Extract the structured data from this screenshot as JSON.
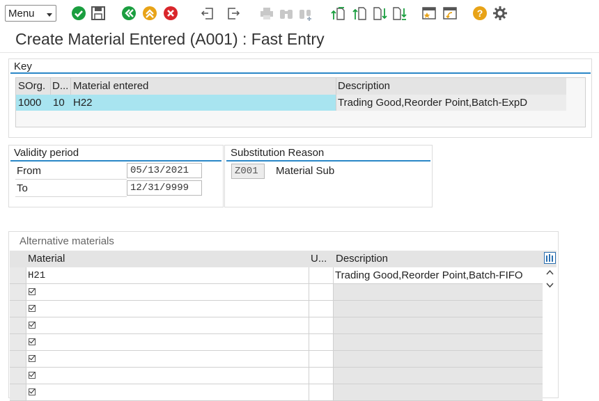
{
  "toolbar": {
    "menu_label": "Menu",
    "icons": [
      "check-icon",
      "save-icon",
      "back-icon",
      "exit-icon",
      "cancel-icon",
      "previous-entry-icon",
      "next-entry-icon",
      "print-icon",
      "find-icon",
      "find-next-icon",
      "first-page-icon",
      "previous-page-icon",
      "next-page-icon",
      "last-page-icon",
      "create-session-icon",
      "generate-shortcut-icon",
      "help-icon",
      "settings-icon"
    ]
  },
  "page": {
    "title": "Create Material Entered (A001) : Fast Entry"
  },
  "key": {
    "group_label": "Key",
    "columns": [
      "SOrg.",
      "D...",
      "Material entered",
      "Description"
    ],
    "row": {
      "sorg": "1000",
      "d": "10",
      "material": "H22",
      "description": "Trading Good,Reorder Point,Batch-ExpD"
    }
  },
  "validity": {
    "group_label": "Validity period",
    "from_label": "From",
    "from_value": "05/13/2021",
    "to_label": "To",
    "to_value": "12/31/9999"
  },
  "substitution": {
    "group_label": "Substitution Reason",
    "code": "Z001",
    "text": "Material Sub"
  },
  "alternatives": {
    "group_label": "Alternative materials",
    "columns": [
      "Material",
      "U...",
      "Description"
    ],
    "rows": [
      {
        "material": "H21",
        "description": "Trading Good,Reorder Point,Batch-FIFO"
      }
    ]
  },
  "colors": {
    "selected_row": "#a8e4f0",
    "accent_line": "#2a87c7",
    "green": "#1a9e3f",
    "orange": "#e8a317",
    "red": "#d9262b"
  }
}
